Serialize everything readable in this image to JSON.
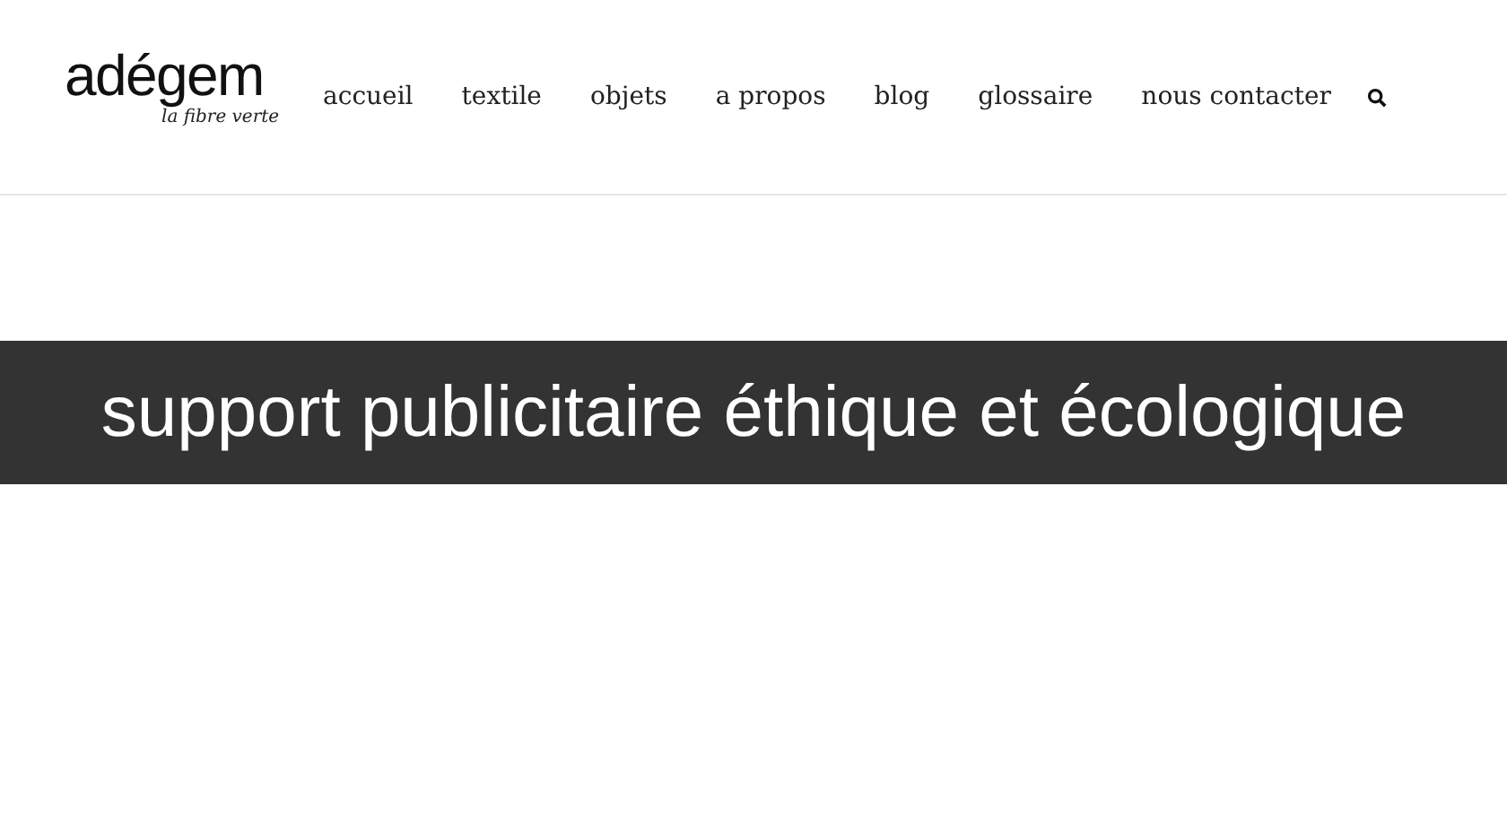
{
  "logo": {
    "name": "adégem",
    "tagline": "la fibre verte"
  },
  "nav": [
    "accueil",
    "textile",
    "objets",
    "a propos",
    "blog",
    "glossaire",
    "nous contacter"
  ],
  "banner": {
    "title": "support publicitaire éthique et écologique"
  }
}
